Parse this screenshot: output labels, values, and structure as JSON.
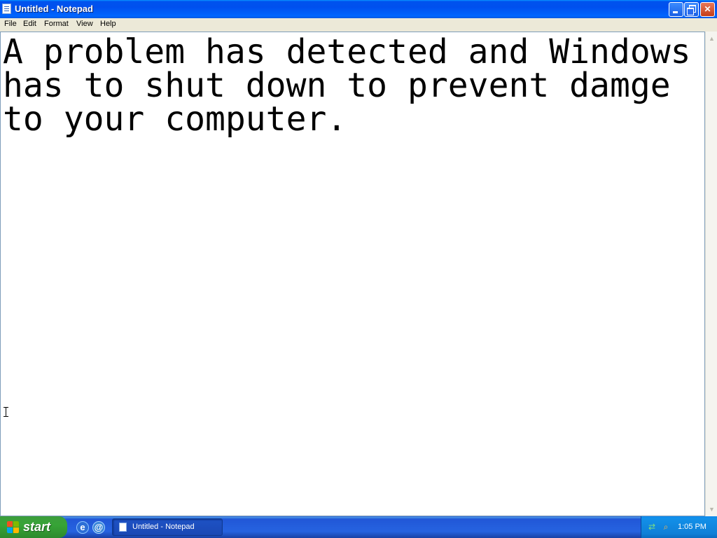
{
  "window": {
    "title": "Untitled - Notepad",
    "controls": {
      "minimize": "minimize",
      "maximize": "restore",
      "close": "✕"
    }
  },
  "menu": [
    "File",
    "Edit",
    "Format",
    "View",
    "Help"
  ],
  "editor": {
    "content": "A problem has detected and Windows\nhas to shut down to prevent damge\nto your computer."
  },
  "taskbar": {
    "start_label": "start",
    "quick_launch": [
      "internet-explorer-icon",
      "outlook-express-icon"
    ],
    "tasks": [
      {
        "label": "Untitled - Notepad"
      }
    ],
    "tray_icons": [
      "network-icon",
      "search-icon"
    ],
    "clock": "1:05 PM"
  },
  "colors": {
    "titlebar": "#0053ee",
    "taskbar": "#2663e0",
    "start": "#37a437",
    "close_button": "#c43d18"
  }
}
